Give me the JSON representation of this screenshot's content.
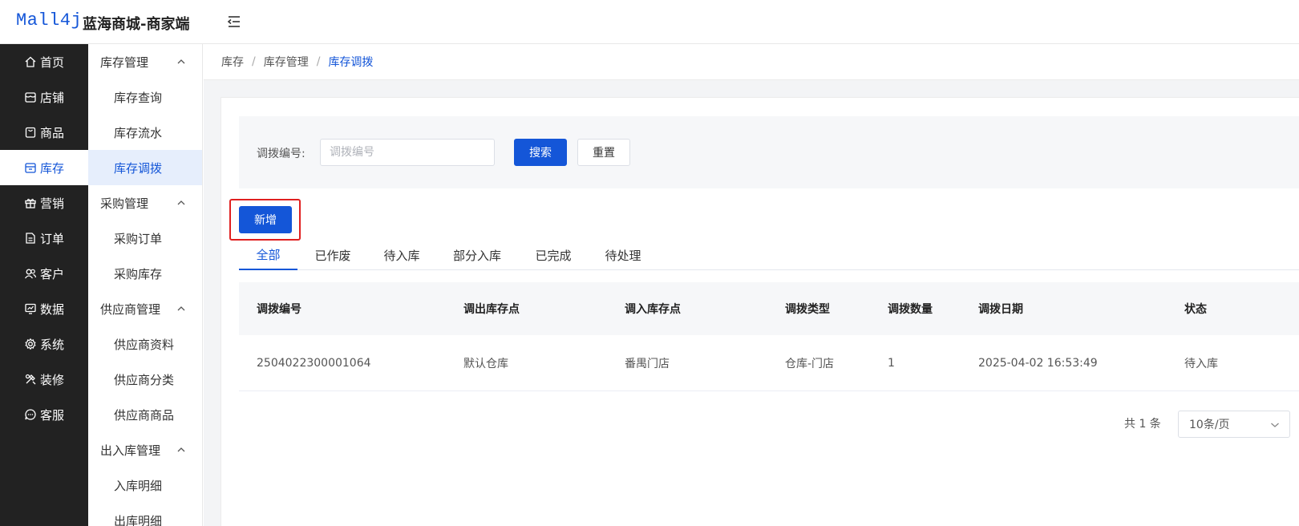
{
  "header": {
    "logo_text": "Mall4j",
    "app_title": "蓝海商城-商家端"
  },
  "colors": {
    "accent": "#1456d8",
    "sidebar_bg": "#222222",
    "highlight": "#e02020"
  },
  "sidebar": {
    "items": [
      {
        "label": "首页",
        "icon": "home-icon"
      },
      {
        "label": "店铺",
        "icon": "shop-icon"
      },
      {
        "label": "商品",
        "icon": "product-icon"
      },
      {
        "label": "库存",
        "icon": "inventory-icon",
        "active": true
      },
      {
        "label": "营销",
        "icon": "gift-icon"
      },
      {
        "label": "订单",
        "icon": "order-icon"
      },
      {
        "label": "客户",
        "icon": "customer-icon"
      },
      {
        "label": "数据",
        "icon": "chart-icon"
      },
      {
        "label": "系统",
        "icon": "gear-icon"
      },
      {
        "label": "装修",
        "icon": "decorate-icon"
      },
      {
        "label": "客服",
        "icon": "chat-icon"
      }
    ]
  },
  "submenu": {
    "groups": [
      {
        "label": "库存管理",
        "items": [
          "库存查询",
          "库存流水",
          "库存调拨"
        ]
      },
      {
        "label": "采购管理",
        "items": [
          "采购订单",
          "采购库存"
        ]
      },
      {
        "label": "供应商管理",
        "items": [
          "供应商资料",
          "供应商分类",
          "供应商商品"
        ]
      },
      {
        "label": "出入库管理",
        "items": [
          "入库明细",
          "出库明细"
        ]
      }
    ],
    "active_item": "库存调拨"
  },
  "breadcrumb": {
    "items": [
      "库存",
      "库存管理",
      "库存调拨"
    ],
    "separator": "/"
  },
  "filter": {
    "label": "调拨编号:",
    "placeholder": "调拨编号",
    "value": "",
    "search_label": "搜索",
    "reset_label": "重置"
  },
  "toolbar": {
    "add_label": "新增"
  },
  "tabs": {
    "items": [
      "全部",
      "已作废",
      "待入库",
      "部分入库",
      "已完成",
      "待处理"
    ],
    "active": "全部"
  },
  "table": {
    "columns": [
      "调拨编号",
      "调出库存点",
      "调入库存点",
      "调拨类型",
      "调拨数量",
      "调拨日期",
      "状态"
    ],
    "rows": [
      [
        "2504022300001064",
        "默认仓库",
        "番禺门店",
        "仓库-门店",
        "1",
        "2025-04-02 16:53:49",
        "待入库"
      ]
    ]
  },
  "pagination": {
    "total_text": "共 1 条",
    "page_size": "10条/页"
  }
}
